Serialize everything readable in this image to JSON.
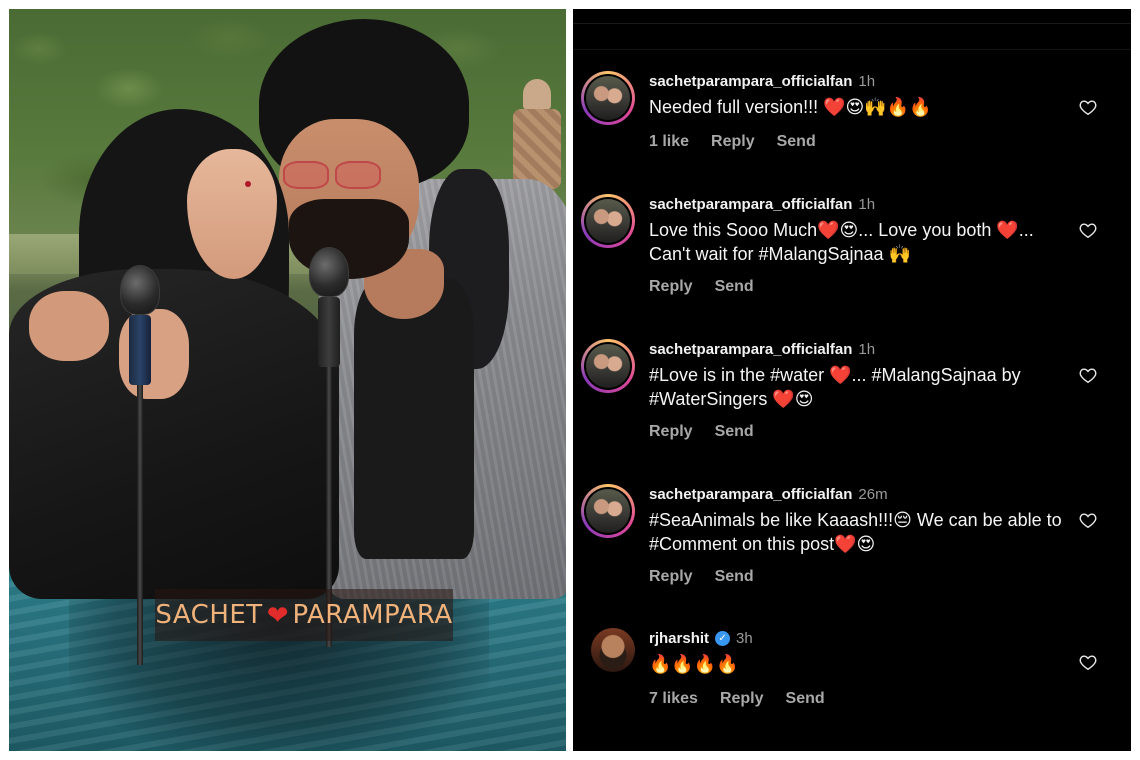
{
  "photo": {
    "caption_left": "SACHET",
    "caption_heart": "❤",
    "caption_right": "PARAMPARA"
  },
  "comments": [
    {
      "username": "sachetparampara_officialfan",
      "time": "1h",
      "text": "Needed full version!!! ❤️😍🙌🔥🔥",
      "likes": "1 like",
      "reply": "Reply",
      "send": "Send"
    },
    {
      "username": "sachetparampara_officialfan",
      "time": "1h",
      "text": "Love this Sooo Much❤️😍... Love you both ❤️... Can't wait for #MalangSajnaa 🙌",
      "reply": "Reply",
      "send": "Send"
    },
    {
      "username": "sachetparampara_officialfan",
      "time": "1h",
      "text": "#Love is in the #water ❤️... #MalangSajnaa by #WaterSingers ❤️😍",
      "reply": "Reply",
      "send": "Send"
    },
    {
      "username": "sachetparampara_officialfan",
      "time": "26m",
      "text": "#SeaAnimals be like Kaaash!!!😔 We can be able to #Comment on this post❤️😍",
      "reply": "Reply",
      "send": "Send"
    },
    {
      "username": "rjharshit",
      "verified": true,
      "time": "3h",
      "text": "🔥🔥🔥🔥",
      "likes": "7 likes",
      "reply": "Reply",
      "send": "Send"
    }
  ],
  "icons": {
    "like": "heart-outline-icon",
    "verified": "verified-badge-icon"
  },
  "colors": {
    "panel_bg": "#000000",
    "username": "#f2f2f2",
    "muted": "#a8a8a8",
    "verified": "#3897f0",
    "caption_text": "#f0b27b",
    "story_ring": "#df4996"
  }
}
